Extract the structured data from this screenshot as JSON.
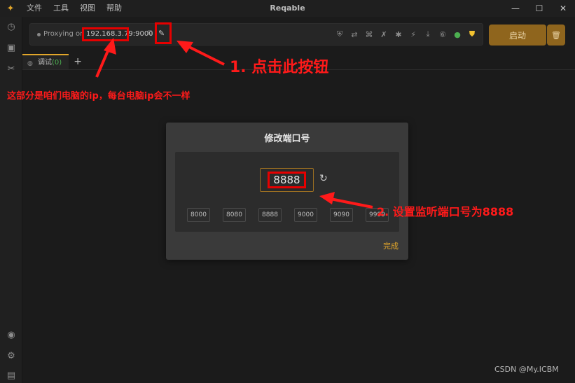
{
  "app": {
    "title": "Reqable",
    "menu": [
      "文件",
      "工具",
      "视图",
      "帮助"
    ]
  },
  "proxy": {
    "label": "Proxying on",
    "address": "192.168.3.79:9000"
  },
  "toolbar": {
    "start_label": "启动"
  },
  "tabs": [
    {
      "label": "调试",
      "count": "(0)"
    }
  ],
  "dialog": {
    "title": "修改端口号",
    "port_value": "8888",
    "presets": [
      "8000",
      "8080",
      "8888",
      "9000",
      "9090",
      "9999"
    ],
    "done_label": "完成"
  },
  "annotations": {
    "step1": "1. 点击此按钮",
    "ip_note": "这部分是咱们电脑的ip，每台电脑ip会不一样",
    "step2": "2. 设置监听端口号为8888"
  },
  "watermark": "CSDN @My.ICBM",
  "colors": {
    "accent": "#e2a62a",
    "start_button": "#8f651d",
    "annotation_red": "#e60000"
  }
}
